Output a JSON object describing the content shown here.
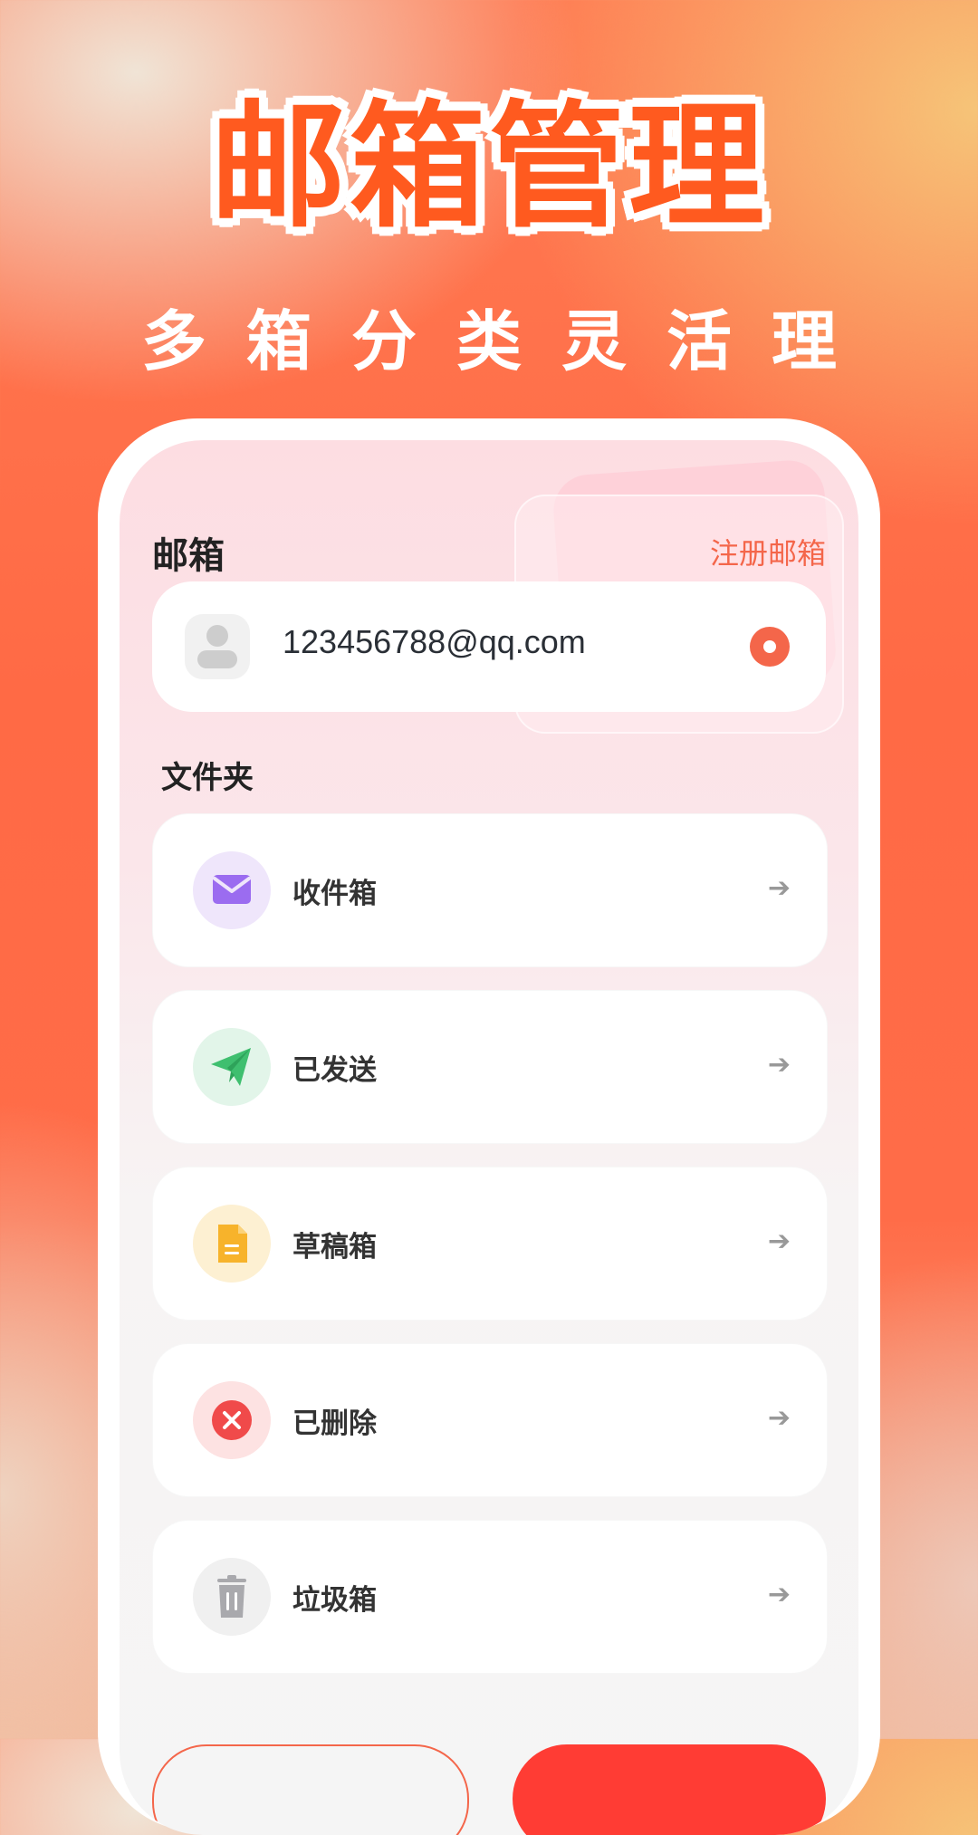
{
  "promo": {
    "title": "邮箱管理",
    "subtitle": "多箱分类灵活理"
  },
  "mailbox": {
    "section_title": "邮箱",
    "register_link": "注册邮箱",
    "account_email": "123456788@qq.com"
  },
  "folders": {
    "section_title": "文件夹",
    "items": [
      {
        "label": "收件箱",
        "icon": "envelope-icon",
        "color": "#9b6cf0",
        "bg": "#efe6fb"
      },
      {
        "label": "已发送",
        "icon": "paper-plane-icon",
        "color": "#3fbf6f",
        "bg": "#e2f5e9"
      },
      {
        "label": "草稿箱",
        "icon": "document-icon",
        "color": "#f7b32b",
        "bg": "#fdf0d2"
      },
      {
        "label": "已删除",
        "icon": "close-circle-icon",
        "color": "#f04a4a",
        "bg": "#fde2e2"
      },
      {
        "label": "垃圾箱",
        "icon": "trash-icon",
        "color": "#a9a9ad",
        "bg": "#f0f0f0"
      }
    ],
    "arrow": "➔"
  },
  "colors": {
    "accent": "#f4664a",
    "title_orange": "#ff5a1f"
  }
}
